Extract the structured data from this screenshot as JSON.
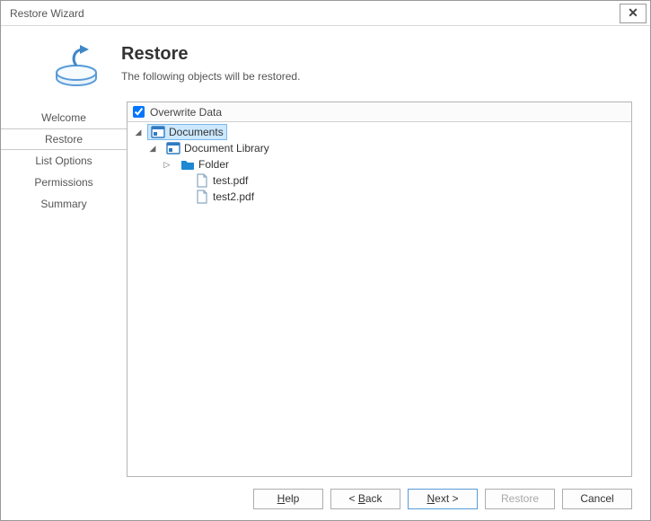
{
  "window": {
    "title": "Restore Wizard"
  },
  "header": {
    "title": "Restore",
    "subtitle": "The following objects will be restored."
  },
  "sidebar": {
    "items": [
      {
        "label": "Welcome",
        "active": false
      },
      {
        "label": "Restore",
        "active": true
      },
      {
        "label": "List Options",
        "active": false
      },
      {
        "label": "Permissions",
        "active": false
      },
      {
        "label": "Summary",
        "active": false
      }
    ]
  },
  "tree": {
    "header_checkbox_checked": true,
    "header_label": "Overwrite Data",
    "nodes": {
      "root": {
        "label": "Documents",
        "icon": "site",
        "selected": true,
        "expander": "down"
      },
      "lib": {
        "label": "Document Library",
        "icon": "site",
        "selected": false,
        "expander": "down"
      },
      "folder": {
        "label": "Folder",
        "icon": "folder",
        "selected": false,
        "expander": "right"
      },
      "file1": {
        "label": "test.pdf",
        "icon": "file",
        "selected": false,
        "expander": "none"
      },
      "file2": {
        "label": "test2.pdf",
        "icon": "file",
        "selected": false,
        "expander": "none"
      }
    }
  },
  "buttons": {
    "help": "Help",
    "back": "< Back",
    "next": "Next >",
    "restore": "Restore",
    "cancel": "Cancel"
  }
}
